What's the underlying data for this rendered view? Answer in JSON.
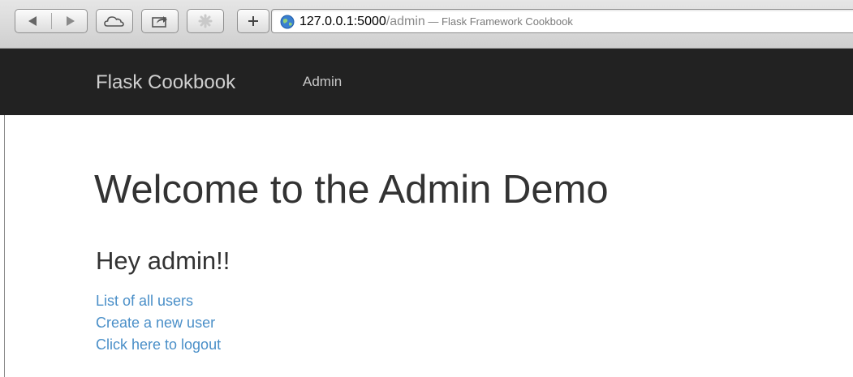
{
  "browser": {
    "url_host": "127.0.0.1:5000",
    "url_path": "/admin",
    "page_title_suffix": " — Flask Framework Cookbook",
    "icons": [
      "back-icon",
      "forward-icon",
      "icloud-icon",
      "share-icon",
      "extensions-icon",
      "add-bookmark-icon",
      "globe-icon"
    ]
  },
  "navbar": {
    "brand": "Flask Cookbook",
    "items": [
      {
        "label": "Admin"
      }
    ]
  },
  "main": {
    "title": "Welcome to the Admin Demo",
    "subtitle": "Hey admin!!",
    "links": [
      {
        "label": "List of all users"
      },
      {
        "label": "Create a new user"
      },
      {
        "label": "Click here to logout"
      }
    ]
  },
  "colors": {
    "navbar_bg": "#222222",
    "link": "#4a8fc8",
    "heading": "#333333"
  }
}
